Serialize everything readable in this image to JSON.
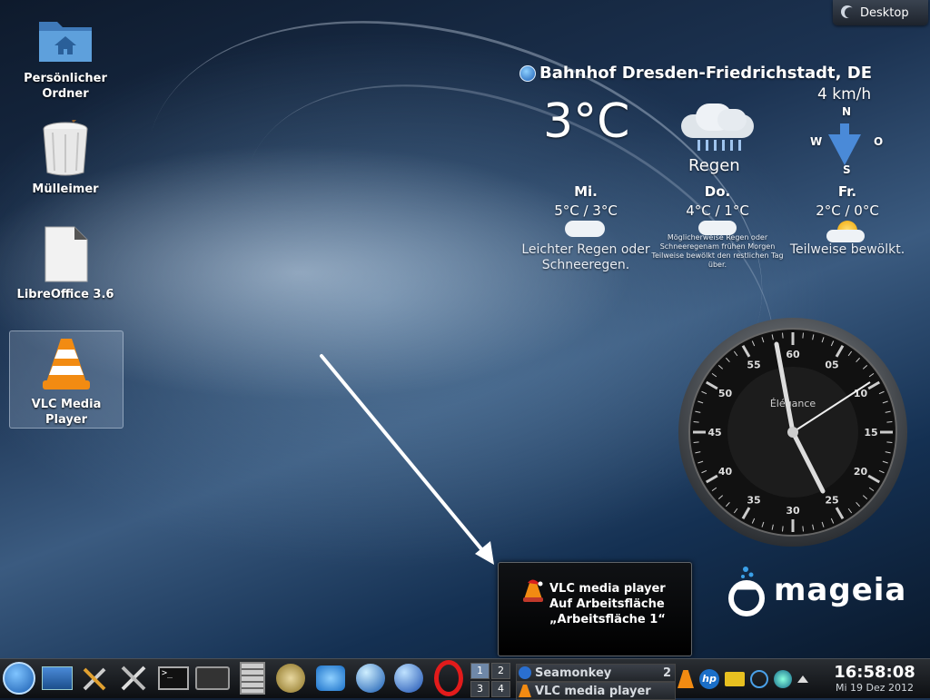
{
  "desktop": {
    "button_label": "Desktop",
    "icons": [
      {
        "label": "Persönlicher Ordner",
        "icon": "home-folder-icon"
      },
      {
        "label": "Mülleimer",
        "icon": "trash-icon"
      },
      {
        "label": "LibreOffice 3.6",
        "icon": "document-icon"
      },
      {
        "label": "VLC Media Player",
        "icon": "vlc-cone-icon"
      }
    ]
  },
  "weather": {
    "station": "Bahnhof Dresden-Friedrichstadt, DE",
    "temperature": "3°C",
    "condition": "Regen",
    "wind_speed": "4 km/h",
    "compass": {
      "n": "N",
      "s": "S",
      "w": "W",
      "o": "O"
    },
    "forecast": [
      {
        "day": "Mi.",
        "temps": "5°C / 3°C",
        "condition": "Leichter Regen oder Schneeregen."
      },
      {
        "day": "Do.",
        "temps": "4°C / 1°C",
        "condition": "Möglicherweise Regen oder Schneeregenam frühen Morgen Teilweise bewölkt den restlichen Tag über."
      },
      {
        "day": "Fr.",
        "temps": "2°C / 0°C",
        "condition": "Teilweise bewölkt."
      }
    ]
  },
  "clock_widget": {
    "brand": "Élégance",
    "numbers": [
      "60",
      "05",
      "10",
      "15",
      "20",
      "25",
      "30",
      "35",
      "40",
      "45",
      "50",
      "55"
    ]
  },
  "logo": {
    "text": "mageia"
  },
  "notification": {
    "title": "VLC media player",
    "line1": "Auf Arbeitsfläche",
    "line2": "„Arbeitsfläche 1“"
  },
  "taskbar": {
    "pager": [
      "1",
      "2",
      "3",
      "4"
    ],
    "tasks": [
      {
        "label": "Seamonkey",
        "count": "2"
      },
      {
        "label": "VLC media player"
      }
    ],
    "time": "16:58:08",
    "date": "Mi 19 Dez 2012"
  },
  "colors": {
    "accent": "#4a8ad8",
    "taskbar": "#1a1d21"
  }
}
